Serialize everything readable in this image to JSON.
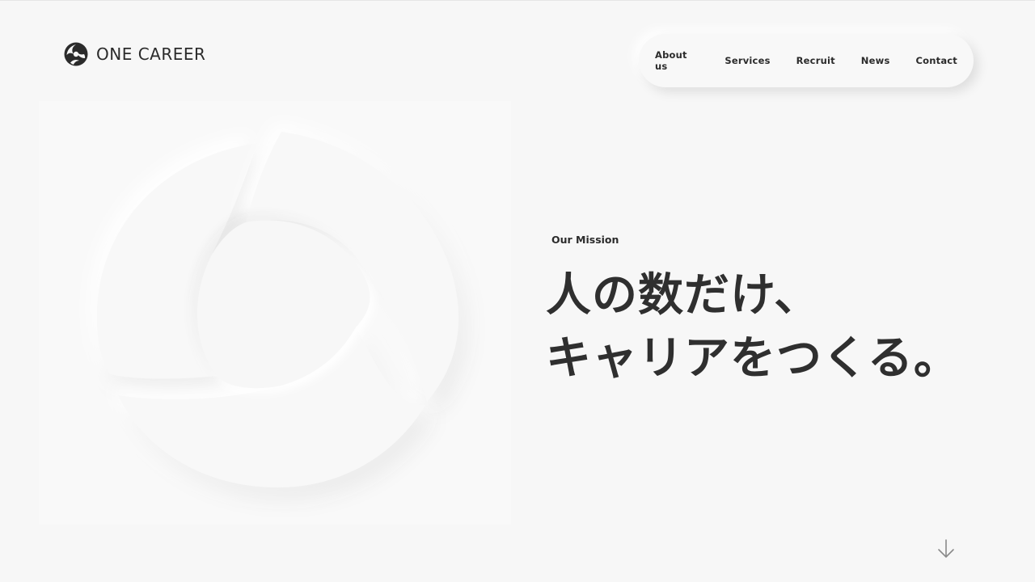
{
  "brand": {
    "name": "ONE CAREER",
    "logo_icon": "one-career-logo-icon"
  },
  "nav": {
    "items": [
      {
        "label": "About us"
      },
      {
        "label": "Services"
      },
      {
        "label": "Recruit"
      },
      {
        "label": "News"
      },
      {
        "label": "Contact"
      }
    ]
  },
  "hero": {
    "emblem_icon": "one-career-emblem-icon",
    "mission_label": "Our Mission",
    "heading_line1": "人の数だけ、",
    "heading_line2": "キャリアをつくる。",
    "scroll_icon": "arrow-down-icon"
  },
  "colors": {
    "background": "#f7f7f7",
    "text": "#2b2b2b",
    "arrow": "#8a8a8a"
  }
}
